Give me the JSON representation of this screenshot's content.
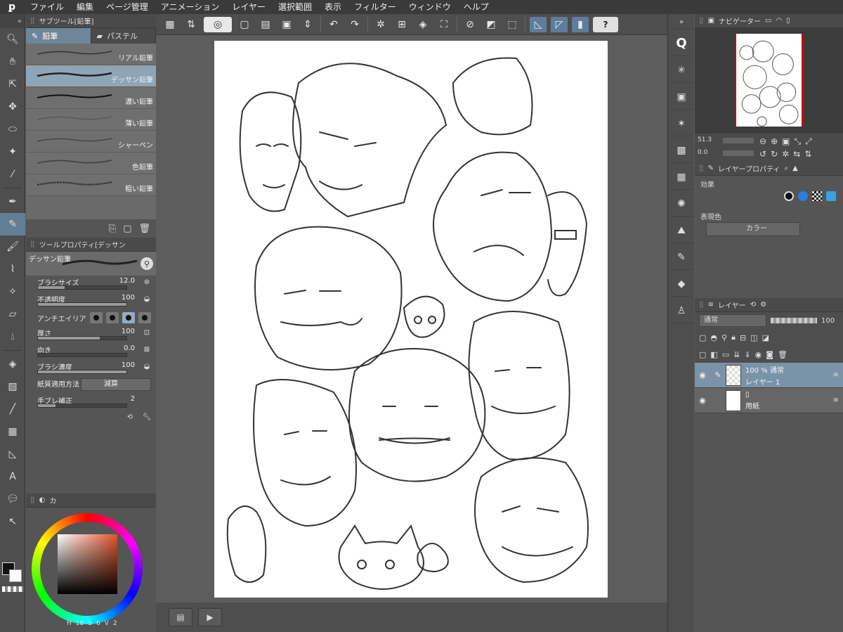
{
  "menu": {
    "items": [
      "ファイル",
      "編集",
      "ページ管理",
      "アニメーション",
      "レイヤー",
      "選択範囲",
      "表示",
      "フィルター",
      "ウィンドウ",
      "ヘルプ"
    ]
  },
  "subtool": {
    "title": "サブツール[鉛筆]",
    "tabs": [
      "鉛筆",
      "パステル"
    ],
    "brushes": [
      "リアル鉛筆",
      "デッサン鉛筆",
      "濃い鉛筆",
      "薄い鉛筆",
      "シャーペン",
      "色鉛筆",
      "粗い鉛筆"
    ],
    "active_brush_index": 1
  },
  "toolprop": {
    "title": "ツールプロパティ[デッサン",
    "brush_name": "デッサン鉛筆",
    "brush_size_label": "ブラシサイズ",
    "brush_size_value": "12.0",
    "opacity_label": "不透明度",
    "opacity_value": "100",
    "antialias_label": "アンチエイリア",
    "thickness_label": "厚さ",
    "thickness_value": "100",
    "direction_label": "向き",
    "direction_value": "0.0",
    "density_label": "ブラシ濃度",
    "density_value": "100",
    "paper_label": "紙質適用方法",
    "paper_value": "減算",
    "stabilize_label": "手ブレ補正",
    "stabilize_value": "2"
  },
  "color": {
    "tab_label": "カ",
    "hue_label": "H",
    "hue_value": "18",
    "sat_label": "S",
    "sat_value": "6",
    "val_label": "V",
    "val_value": "2",
    "accent": "#e0542b"
  },
  "navigator": {
    "title": "ナビゲーター",
    "zoom_value": "51.3",
    "rotate_value": "0.0"
  },
  "layer_property": {
    "title": "レイヤープロパティ",
    "effect_label": "効果",
    "expression_label": "表現色",
    "expression_value": "カラー"
  },
  "layers": {
    "title": "レイヤー",
    "blend_mode": "通常",
    "opacity": "100",
    "rows": [
      {
        "line1": "100 % 通常",
        "line2": "レイヤー 1"
      },
      {
        "line1": "",
        "line2": "用紙"
      }
    ]
  },
  "icons": {
    "help": "?"
  }
}
